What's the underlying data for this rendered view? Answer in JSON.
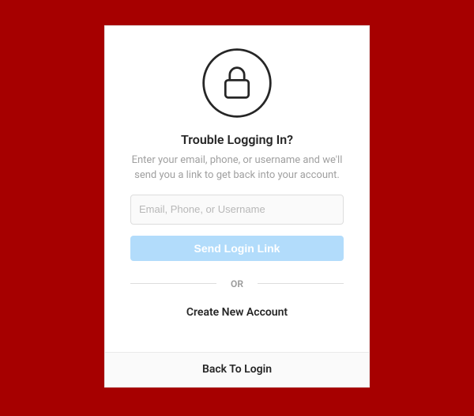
{
  "icon": "lock-icon",
  "title": "Trouble Logging In?",
  "subtitle": "Enter your email, phone, or username and we'll send you a link to get back into your account.",
  "input": {
    "placeholder": "Email, Phone, or Username",
    "value": ""
  },
  "send_button_label": "Send Login Link",
  "divider_text": "OR",
  "create_account_label": "Create New Account",
  "back_to_login_label": "Back To Login",
  "colors": {
    "background": "#a60000",
    "button_disabled": "#b2dcfb"
  }
}
